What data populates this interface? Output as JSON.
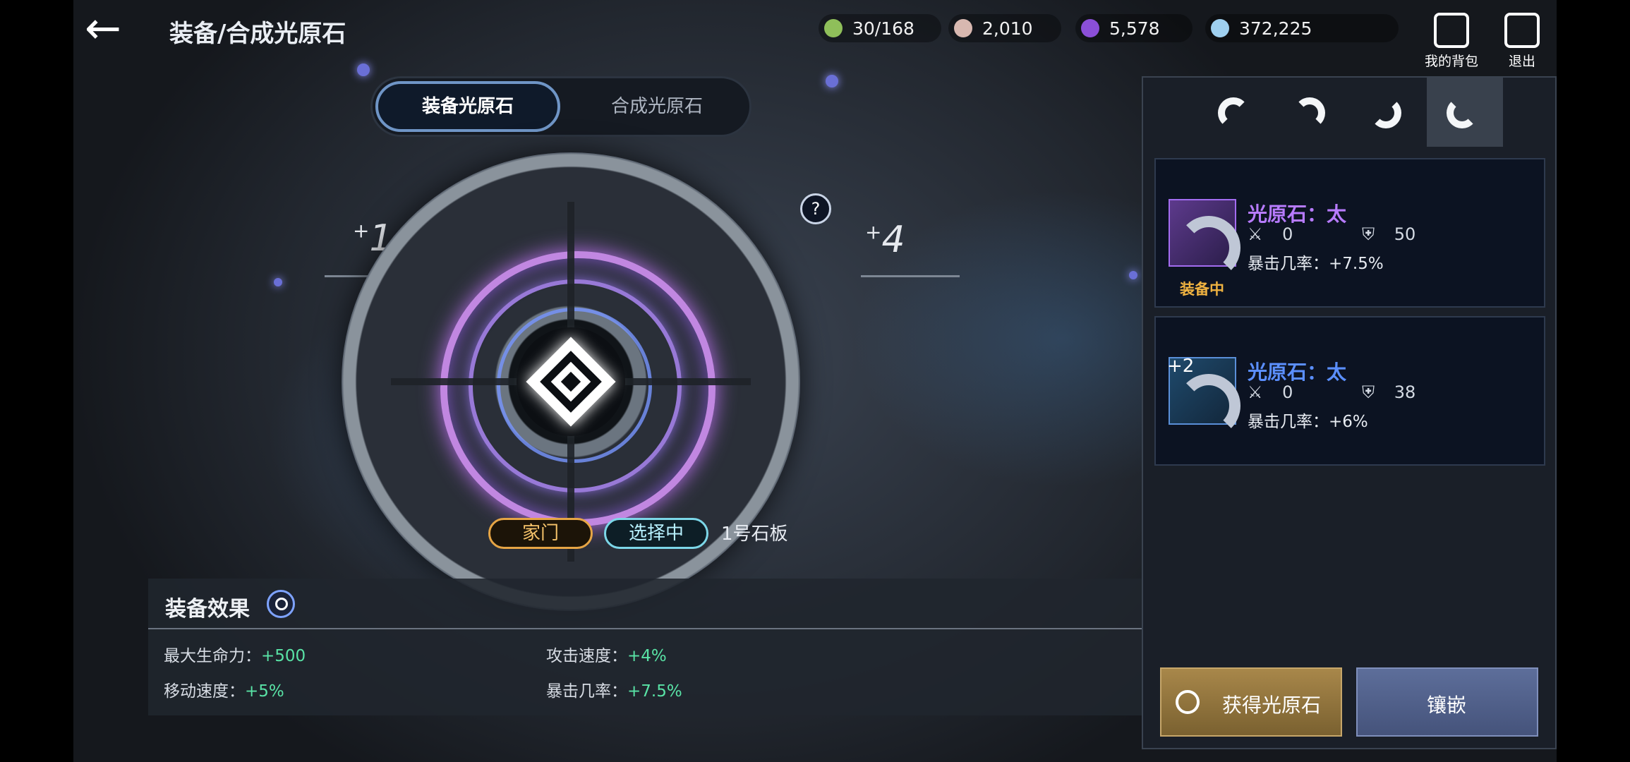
{
  "header": {
    "title": "装备/合成光原石",
    "resources": [
      {
        "icon": "energy-icon",
        "value": "30/168",
        "color": "#8fbf5a"
      },
      {
        "icon": "pearl-icon",
        "value": "2,010",
        "color": "#d8b8b0"
      },
      {
        "icon": "purple-orb-icon",
        "value": "5,578",
        "color": "#8b4fd8"
      },
      {
        "icon": "crystal-icon",
        "value": "372,225",
        "color": "#9fd0f0"
      }
    ],
    "bag_label": "我的背包",
    "exit_label": "退出"
  },
  "tabs": {
    "equip": "装备光原石",
    "craft": "合成光原石"
  },
  "wheel": {
    "left_level": "1",
    "right_level": "4",
    "help_icon": "?",
    "tag_home": "家门",
    "tag_selected": "选择中",
    "board_label": "1号石板"
  },
  "effects": {
    "title": "装备效果",
    "rows": [
      {
        "label": "最大生命力：",
        "value": "+500"
      },
      {
        "label": "攻击速度：",
        "value": "+4%"
      },
      {
        "label": "移动速度：",
        "value": "+5%"
      },
      {
        "label": "暴击几率：",
        "value": "+7.5%"
      }
    ]
  },
  "panel": {
    "items": [
      {
        "name": "光原石：太",
        "name_color": "#b77bff",
        "attack": "0",
        "defense": "50",
        "crit": "暴击几率：+7.5%",
        "status": "装备中",
        "plus": ""
      },
      {
        "name": "光原石：太",
        "name_color": "#5b8fff",
        "attack": "0",
        "defense": "38",
        "crit": "暴击几率：+6%",
        "status": "",
        "plus": "+2"
      }
    ],
    "get_button": "获得光原石",
    "inlay_button": "镶嵌"
  }
}
